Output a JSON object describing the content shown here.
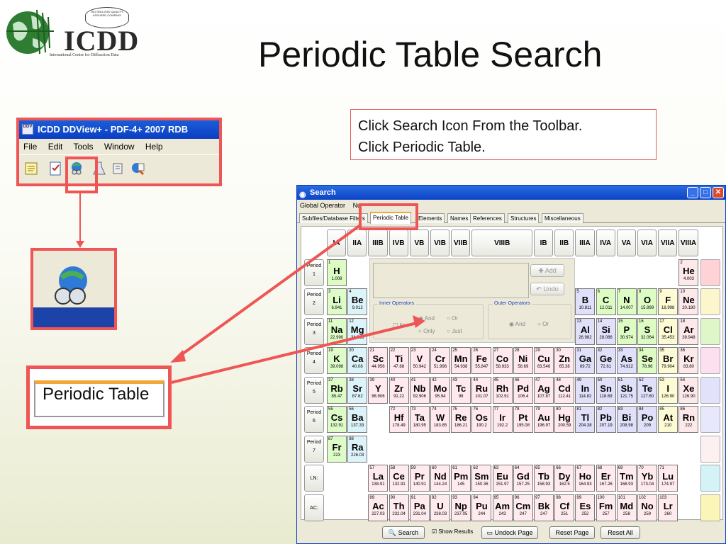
{
  "slide": {
    "title": "Periodic Table Search",
    "logo": {
      "name": "ICDD",
      "subtitle": "International Centre for Diffraction Data",
      "badge": "ISO 9001:2000 QUALITY ASSURED COMPANY"
    },
    "instructions": [
      "Click Search Icon From the Toolbar.",
      "Click Periodic Table."
    ]
  },
  "mini_window": {
    "title": "ICDD DDView+ - PDF-4+ 2007 RDB",
    "app_icon_text": "DDV",
    "menu": [
      "File",
      "Edit",
      "Tools",
      "Window",
      "Help"
    ],
    "toolbar_icons": [
      "notepad-icon",
      "checklist-icon",
      "globe-binoculars-icon",
      "flask-icon",
      "scroll-icon",
      "globe-magnifier-icon"
    ]
  },
  "zoom_callout": {
    "label": "Periodic Table"
  },
  "search_window": {
    "title": "Search",
    "menu": [
      "Global Operator",
      "Nu"
    ],
    "tabs": [
      "Subfiles/Database Filters",
      "Periodic Table",
      "Elements",
      "Names",
      "References",
      "Structures",
      "Miscellaneous"
    ],
    "active_tab": "Periodic Table",
    "groups": [
      "IA",
      "IIA",
      "IIIB",
      "IVB",
      "VB",
      "VIB",
      "VIIB",
      "VIIIB",
      "IB",
      "IIB",
      "IIIA",
      "IVA",
      "VA",
      "VIA",
      "VIIA",
      "VIIIA"
    ],
    "period_label": "Period",
    "periods": [
      "1",
      "2",
      "3",
      "4",
      "5",
      "6",
      "7"
    ],
    "series_labels": [
      "LN:",
      "AC:"
    ],
    "controls": {
      "add": "Add",
      "undo": "Undo",
      "inner_operators": "Inner Operators",
      "outer_operators": "Outer Operators",
      "not": "Not",
      "and": "And",
      "or": "Or",
      "only": "Only",
      "just": "Just"
    },
    "buttons": {
      "search": "Search",
      "show_results": "Show Results",
      "undock": "Undock Page",
      "reset": "Reset Page",
      "reset_all": "Reset All"
    },
    "elements": [
      {
        "n": "1",
        "s": "H",
        "m": "1.008"
      },
      {
        "n": "2",
        "s": "He",
        "m": "4.003"
      },
      {
        "n": "3",
        "s": "Li",
        "m": "6.941"
      },
      {
        "n": "4",
        "s": "Be",
        "m": "9.012"
      },
      {
        "n": "5",
        "s": "B",
        "m": "10.811"
      },
      {
        "n": "6",
        "s": "C",
        "m": "12.011"
      },
      {
        "n": "7",
        "s": "N",
        "m": "14.007"
      },
      {
        "n": "8",
        "s": "O",
        "m": "15.999"
      },
      {
        "n": "9",
        "s": "F",
        "m": "18.998"
      },
      {
        "n": "10",
        "s": "Ne",
        "m": "20.180"
      },
      {
        "n": "11",
        "s": "Na",
        "m": "22.990"
      },
      {
        "n": "12",
        "s": "Mg",
        "m": "24.305"
      },
      {
        "n": "13",
        "s": "Al",
        "m": "26.982"
      },
      {
        "n": "14",
        "s": "Si",
        "m": "28.086"
      },
      {
        "n": "15",
        "s": "P",
        "m": "30.974"
      },
      {
        "n": "16",
        "s": "S",
        "m": "32.064"
      },
      {
        "n": "17",
        "s": "Cl",
        "m": "35.453"
      },
      {
        "n": "18",
        "s": "Ar",
        "m": "39.948"
      },
      {
        "n": "19",
        "s": "K",
        "m": "39.098"
      },
      {
        "n": "20",
        "s": "Ca",
        "m": "40.08"
      },
      {
        "n": "21",
        "s": "Sc",
        "m": "44.956"
      },
      {
        "n": "22",
        "s": "Ti",
        "m": "47.88"
      },
      {
        "n": "23",
        "s": "V",
        "m": "50.942"
      },
      {
        "n": "24",
        "s": "Cr",
        "m": "51.996"
      },
      {
        "n": "25",
        "s": "Mn",
        "m": "54.938"
      },
      {
        "n": "26",
        "s": "Fe",
        "m": "55.847"
      },
      {
        "n": "27",
        "s": "Co",
        "m": "58.933"
      },
      {
        "n": "28",
        "s": "Ni",
        "m": "58.69"
      },
      {
        "n": "29",
        "s": "Cu",
        "m": "63.546"
      },
      {
        "n": "30",
        "s": "Zn",
        "m": "65.38"
      },
      {
        "n": "31",
        "s": "Ga",
        "m": "69.72"
      },
      {
        "n": "32",
        "s": "Ge",
        "m": "72.61"
      },
      {
        "n": "33",
        "s": "As",
        "m": "74.922"
      },
      {
        "n": "34",
        "s": "Se",
        "m": "78.96"
      },
      {
        "n": "35",
        "s": "Br",
        "m": "79.904"
      },
      {
        "n": "36",
        "s": "Kr",
        "m": "83.80"
      },
      {
        "n": "37",
        "s": "Rb",
        "m": "85.47"
      },
      {
        "n": "38",
        "s": "Sr",
        "m": "87.62"
      },
      {
        "n": "39",
        "s": "Y",
        "m": "88.906"
      },
      {
        "n": "40",
        "s": "Zr",
        "m": "91.22"
      },
      {
        "n": "41",
        "s": "Nb",
        "m": "92.906"
      },
      {
        "n": "42",
        "s": "Mo",
        "m": "95.94"
      },
      {
        "n": "43",
        "s": "Tc",
        "m": "98"
      },
      {
        "n": "44",
        "s": "Ru",
        "m": "101.07"
      },
      {
        "n": "45",
        "s": "Rh",
        "m": "102.91"
      },
      {
        "n": "46",
        "s": "Pd",
        "m": "106.4"
      },
      {
        "n": "47",
        "s": "Ag",
        "m": "107.87"
      },
      {
        "n": "48",
        "s": "Cd",
        "m": "112.41"
      },
      {
        "n": "49",
        "s": "In",
        "m": "114.82"
      },
      {
        "n": "50",
        "s": "Sn",
        "m": "118.69"
      },
      {
        "n": "51",
        "s": "Sb",
        "m": "121.75"
      },
      {
        "n": "52",
        "s": "Te",
        "m": "127.60"
      },
      {
        "n": "53",
        "s": "I",
        "m": "126.90"
      },
      {
        "n": "54",
        "s": "Xe",
        "m": "126.90"
      },
      {
        "n": "55",
        "s": "Cs",
        "m": "132.91"
      },
      {
        "n": "56",
        "s": "Ba",
        "m": "137.33"
      },
      {
        "n": "72",
        "s": "Hf",
        "m": "178.49"
      },
      {
        "n": "73",
        "s": "Ta",
        "m": "180.95"
      },
      {
        "n": "74",
        "s": "W",
        "m": "183.85"
      },
      {
        "n": "75",
        "s": "Re",
        "m": "186.21"
      },
      {
        "n": "76",
        "s": "Os",
        "m": "190.2"
      },
      {
        "n": "77",
        "s": "Ir",
        "m": "192.2"
      },
      {
        "n": "78",
        "s": "Pt",
        "m": "195.08"
      },
      {
        "n": "79",
        "s": "Au",
        "m": "196.97"
      },
      {
        "n": "80",
        "s": "Hg",
        "m": "200.59"
      },
      {
        "n": "81",
        "s": "Tl",
        "m": "204.38"
      },
      {
        "n": "82",
        "s": "Pb",
        "m": "207.19"
      },
      {
        "n": "83",
        "s": "Bi",
        "m": "208.98"
      },
      {
        "n": "84",
        "s": "Po",
        "m": "209"
      },
      {
        "n": "85",
        "s": "At",
        "m": "210"
      },
      {
        "n": "86",
        "s": "Rn",
        "m": "222"
      },
      {
        "n": "87",
        "s": "Fr",
        "m": "223"
      },
      {
        "n": "88",
        "s": "Ra",
        "m": "226.03"
      },
      {
        "n": "57",
        "s": "La",
        "m": "138.91"
      },
      {
        "n": "58",
        "s": "Ce",
        "m": "132.91"
      },
      {
        "n": "59",
        "s": "Pr",
        "m": "140.91"
      },
      {
        "n": "60",
        "s": "Nd",
        "m": "144.24"
      },
      {
        "n": "61",
        "s": "Pm",
        "m": "145"
      },
      {
        "n": "62",
        "s": "Sm",
        "m": "150.36"
      },
      {
        "n": "63",
        "s": "Eu",
        "m": "151.97"
      },
      {
        "n": "64",
        "s": "Gd",
        "m": "157.25"
      },
      {
        "n": "65",
        "s": "Tb",
        "m": "158.93"
      },
      {
        "n": "66",
        "s": "Dy",
        "m": "162.5"
      },
      {
        "n": "67",
        "s": "Ho",
        "m": "164.93"
      },
      {
        "n": "68",
        "s": "Er",
        "m": "167.26"
      },
      {
        "n": "69",
        "s": "Tm",
        "m": "168.93"
      },
      {
        "n": "70",
        "s": "Yb",
        "m": "173.04"
      },
      {
        "n": "71",
        "s": "Lu",
        "m": "174.97"
      },
      {
        "n": "89",
        "s": "Ac",
        "m": "227.03"
      },
      {
        "n": "90",
        "s": "Th",
        "m": "232.04"
      },
      {
        "n": "91",
        "s": "Pa",
        "m": "231.04"
      },
      {
        "n": "92",
        "s": "U",
        "m": "238.03"
      },
      {
        "n": "93",
        "s": "Np",
        "m": "237.05"
      },
      {
        "n": "94",
        "s": "Pu",
        "m": "244"
      },
      {
        "n": "95",
        "s": "Am",
        "m": "243"
      },
      {
        "n": "96",
        "s": "Cm",
        "m": "247"
      },
      {
        "n": "97",
        "s": "Bk",
        "m": "247"
      },
      {
        "n": "98",
        "s": "Cf",
        "m": "251"
      },
      {
        "n": "99",
        "s": "Es",
        "m": "252"
      },
      {
        "n": "100",
        "s": "Fm",
        "m": "257"
      },
      {
        "n": "101",
        "s": "Md",
        "m": "258"
      },
      {
        "n": "102",
        "s": "No",
        "m": "259"
      },
      {
        "n": "103",
        "s": "Lr",
        "m": "260"
      }
    ]
  },
  "colors": {
    "callout_red": "#ef5555",
    "xp_blue": "#0c43c5",
    "group1": "#ddfcc8",
    "alkaline": "#dcf3fa",
    "transition": "#ffe9ef",
    "post": "#e0e0fa",
    "nonmetal": "#dcfcc4",
    "halogen": "#fdfbd4",
    "noble": "#fde8ea",
    "lanth": "#ffeaee"
  }
}
